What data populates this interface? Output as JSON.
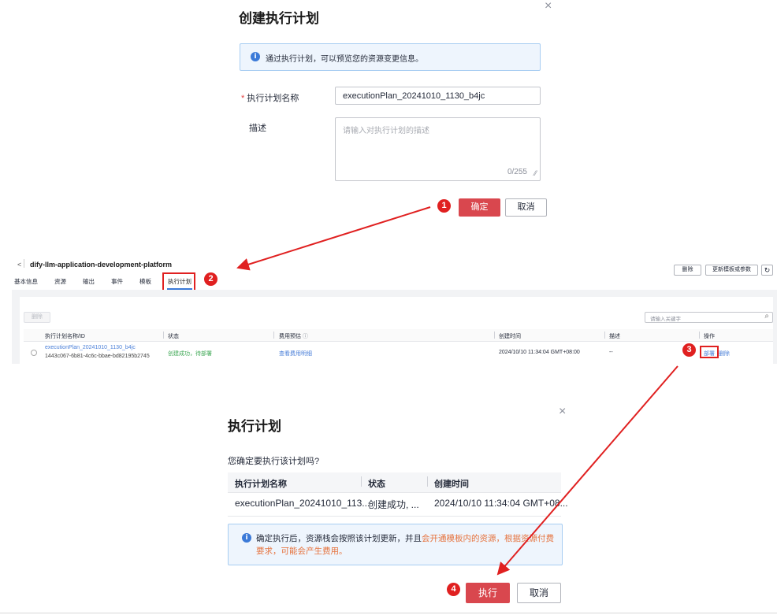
{
  "dialog1": {
    "title": "创建执行计划",
    "close": "×",
    "info": "通过执行计划，可以预览您的资源变更信息。",
    "name_required_mark": "*",
    "name_label": "执行计划名称",
    "name_value": "executionPlan_20241010_1130_b4jc",
    "desc_label": "描述",
    "desc_placeholder": "请输入对执行计划的描述",
    "counter": "0/255",
    "confirm": "确定",
    "cancel": "取消"
  },
  "stack_page": {
    "back": "<",
    "stack_name": "dify-llm-application-development-platform",
    "delete_btn": "删除",
    "update_btn": "更新模板或参数",
    "refresh_icon": "refresh-icon",
    "tabs": [
      "基本信息",
      "资源",
      "输出",
      "事件",
      "模板",
      "执行计划"
    ],
    "active_tab": "执行计划",
    "toolbar_delete": "删除",
    "search_placeholder": "请输入关键字",
    "columns": [
      "执行计划名称/ID",
      "状态",
      "费用预估",
      "创建时间",
      "描述",
      "操作"
    ],
    "row": {
      "name": "executionPlan_20241010_1130_b4jc",
      "id": "1443c067-6b81-4c6c-bbae-bd82195b2745",
      "status": "创建成功，待部署",
      "cost": "查看费用明细",
      "created": "2024/10/10 11:34:04 GMT+08:00",
      "desc": "--",
      "deploy": "部署",
      "delete": "删除"
    }
  },
  "dialog2": {
    "title": "执行计划",
    "close": "×",
    "question": "您确定要执行该计划吗?",
    "columns": [
      "执行计划名称",
      "状态",
      "创建时间"
    ],
    "row": {
      "name": "executionPlan_20241010_113...",
      "status": "创建成功, ...",
      "created": "2024/10/10 11:34:04 GMT+08..."
    },
    "info_normal": "确定执行后，资源栈会按照该计划更新，并且",
    "info_highlight": "会开通模板内的资源，根据资源付费要求，可能会产生费用。",
    "execute": "执行",
    "cancel": "取消"
  },
  "steps": [
    "1",
    "2",
    "3",
    "4"
  ],
  "colors": {
    "primary": "#d9474e",
    "annotation": "#e02020",
    "link": "#4a7fd8",
    "info_bg": "#eef5fd"
  }
}
